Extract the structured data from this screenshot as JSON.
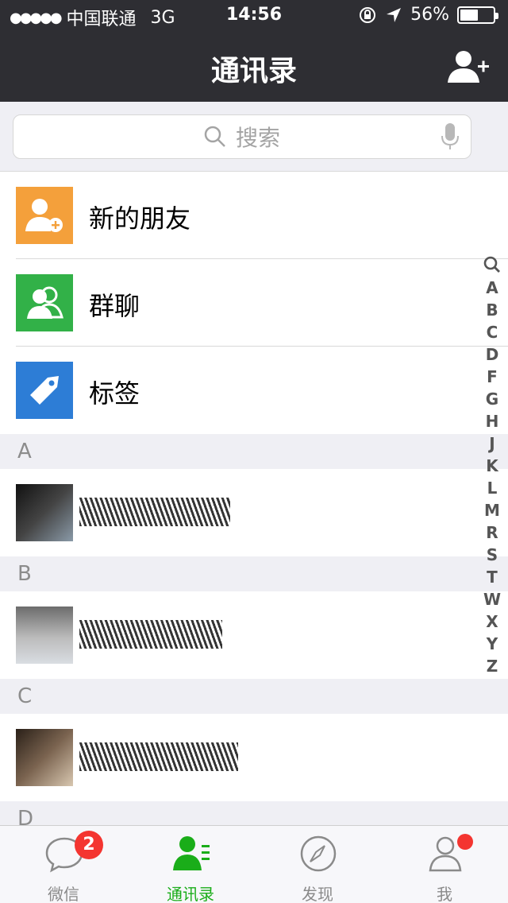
{
  "status": {
    "carrier": "中国联通",
    "network": "3G",
    "time": "14:56",
    "battery": "56%",
    "battery_level": 0.56
  },
  "nav": {
    "title": "通讯录"
  },
  "search": {
    "placeholder": "搜索"
  },
  "fixed": [
    {
      "label": "新的朋友",
      "color": "#f4a03b",
      "icon": "add-friend-icon"
    },
    {
      "label": "群聊",
      "color": "#32b148",
      "icon": "group-chat-icon"
    },
    {
      "label": "标签",
      "color": "#2d7dd6",
      "icon": "tag-icon"
    }
  ],
  "sections": [
    {
      "letter": "A"
    },
    {
      "letter": "B"
    },
    {
      "letter": "C"
    },
    {
      "letter": "D"
    }
  ],
  "index": [
    "A",
    "B",
    "C",
    "D",
    "F",
    "G",
    "H",
    "J",
    "K",
    "L",
    "M",
    "R",
    "S",
    "T",
    "W",
    "X",
    "Y",
    "Z"
  ],
  "tabs": [
    {
      "label": "微信",
      "badge": "2"
    },
    {
      "label": "通讯录"
    },
    {
      "label": "发现"
    },
    {
      "label": "我"
    }
  ],
  "colors": {
    "accent": "#1aad19",
    "header": "#2e2e33",
    "badge": "#f43530"
  }
}
